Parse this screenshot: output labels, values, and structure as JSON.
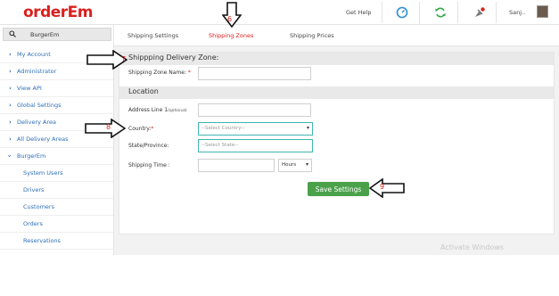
{
  "header": {
    "logo": "orderEm",
    "get_help": "Get Help",
    "user_name": "Sanj..",
    "icons": [
      "dashboard-icon",
      "refresh-icon",
      "notification-icon"
    ]
  },
  "sidebar": {
    "search_value": "BurgerEm",
    "items": [
      {
        "label": "My Account"
      },
      {
        "label": "Administrator"
      },
      {
        "label": "View API"
      },
      {
        "label": "Global Settings"
      },
      {
        "label": "Delivery Area"
      },
      {
        "label": "All Delivery Areas"
      },
      {
        "label": "BurgerEm"
      }
    ],
    "subitems": [
      {
        "label": "System Users"
      },
      {
        "label": "Drivers"
      },
      {
        "label": "Customers"
      },
      {
        "label": "Orders"
      },
      {
        "label": "Reservations"
      }
    ]
  },
  "tabs": [
    {
      "label": "Shipping Settings",
      "active": false
    },
    {
      "label": "Shipping Zones",
      "active": true
    },
    {
      "label": "Shipping Prices",
      "active": false
    }
  ],
  "form": {
    "zone_section_title": "Shippping Delivery Zone:",
    "zone_name_label": "Shipping Zone Name:",
    "zone_name_value": "",
    "location_title": "Location",
    "address_label": "Address Line 1",
    "address_optional": "(optional)",
    "country_label": "Country:",
    "country_placeholder": "--Select Country--",
    "state_label": "State/Province:",
    "state_placeholder": "--Select State--",
    "time_label": "Shipping Time :",
    "time_unit": "Hours",
    "save_label": "Save Settings"
  },
  "annotations": [
    "6",
    "7",
    "8",
    "9"
  ],
  "watermark": "Activate Windows",
  "colors": {
    "brand": "#d9211e",
    "link": "#2c6fb6",
    "save": "#4aa14a",
    "focus": "#3fb5b0"
  }
}
